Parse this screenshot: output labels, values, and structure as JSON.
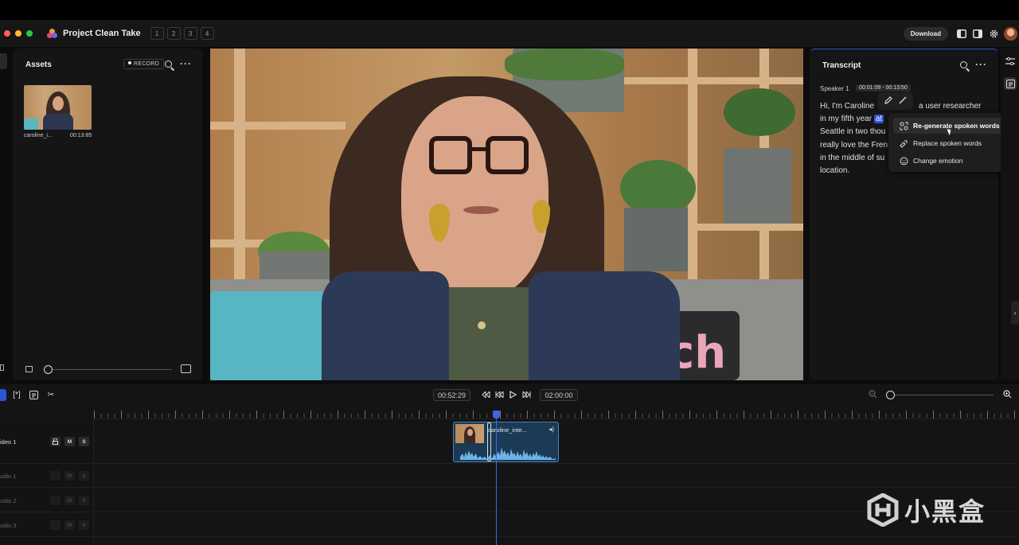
{
  "window": {
    "dot_colors": [
      "#ff5f57",
      "#febc2e",
      "#28c840"
    ]
  },
  "header": {
    "title": "Project Clean Take",
    "tabs": [
      "1",
      "2",
      "3",
      "4"
    ],
    "download_label": "Download"
  },
  "assets": {
    "title": "Assets",
    "record_label": "RECORD",
    "items": [
      {
        "name": "caroline_i...",
        "duration": "00:13:85"
      }
    ]
  },
  "transcript": {
    "title": "Transcript",
    "speaker": "Speaker 1",
    "timestamp": "00:01:09 - 00:13:50",
    "lines_left": [
      "Hi, I'm Caroline",
      "in my fifth year",
      "Seattle in two thou",
      "really love the Fren",
      "in the middle of su",
      "location."
    ],
    "highlight_word": "at",
    "line1_right": "a user researcher",
    "context_menu": [
      {
        "label": "Re-generate spoken words",
        "icon": "regenerate-icon",
        "active": true
      },
      {
        "label": "Replace spoken words",
        "icon": "replace-icon",
        "active": false
      },
      {
        "label": "Change emotion",
        "icon": "emotion-icon",
        "active": false,
        "submenu": true
      }
    ]
  },
  "timeline": {
    "current_time": "00:52:29",
    "total_time": "02:00:00",
    "tracks": [
      {
        "label": "ideo 1",
        "buttons": [
          "M",
          "S"
        ],
        "dim": false
      },
      {
        "label": "udio 1",
        "buttons": [
          "M",
          "S"
        ],
        "dim": true
      },
      {
        "label": "udio 2",
        "buttons": [
          "M",
          "S"
        ],
        "dim": true
      },
      {
        "label": "udio 3",
        "buttons": [
          "M",
          "S"
        ],
        "dim": true
      }
    ],
    "clip": {
      "name": "caroline_inte..."
    }
  },
  "watermark": {
    "text": "小黑盒"
  },
  "colors": {
    "accent": "#2f52d6",
    "playhead": "#3f66e8",
    "clip_bg": "#1b3a55"
  }
}
